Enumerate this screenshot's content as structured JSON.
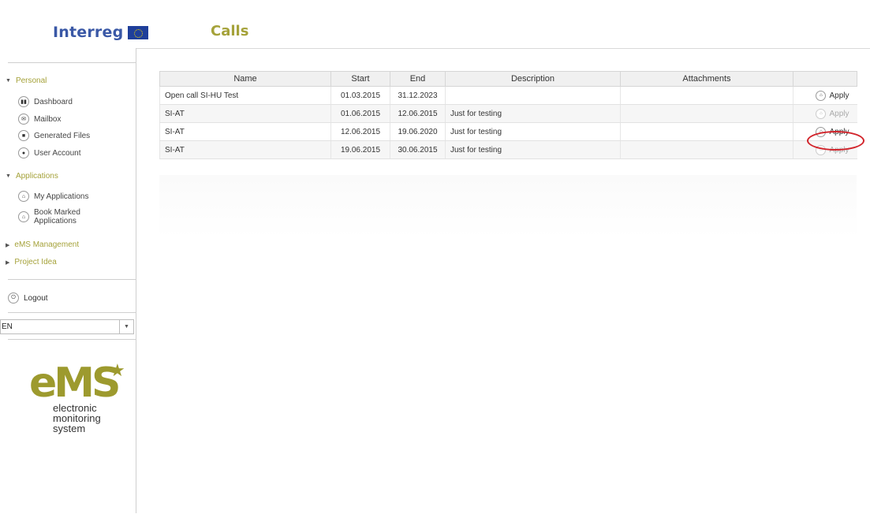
{
  "header": {
    "logo_text": "Interreg",
    "page_title": "Calls"
  },
  "sidebar": {
    "sections": [
      {
        "label": "Personal",
        "expanded": true
      },
      {
        "label": "Applications",
        "expanded": true
      },
      {
        "label": "eMS Management",
        "expanded": false
      },
      {
        "label": "Project Idea",
        "expanded": false
      }
    ],
    "personal_items": [
      {
        "label": "Dashboard",
        "icon": "dashboard-icon"
      },
      {
        "label": "Mailbox",
        "icon": "mail-icon"
      },
      {
        "label": "Generated Files",
        "icon": "files-icon"
      },
      {
        "label": "User Account",
        "icon": "user-icon"
      }
    ],
    "application_items": [
      {
        "label": "My Applications",
        "icon": "applications-icon"
      },
      {
        "label_line1": "Book Marked",
        "label_line2": "Applications",
        "icon": "bookmark-icon"
      }
    ],
    "logout_label": "Logout",
    "language": {
      "selected": "EN"
    },
    "ems_logo": {
      "word": "eMS",
      "line1": "electronic",
      "line2": "monitoring",
      "line3": "system"
    }
  },
  "calls_table": {
    "columns": [
      "Name",
      "Start",
      "End",
      "Description",
      "Attachments",
      ""
    ],
    "rows": [
      {
        "name": "Open call SI-HU Test",
        "start": "01.03.2015",
        "end": "31.12.2023",
        "description": "",
        "attachments": "",
        "action": "Apply",
        "enabled": true
      },
      {
        "name": "SI-AT",
        "start": "01.06.2015",
        "end": "12.06.2015",
        "description": "Just for testing",
        "attachments": "",
        "action": "Apply",
        "enabled": false
      },
      {
        "name": "SI-AT",
        "start": "12.06.2015",
        "end": "19.06.2020",
        "description": "Just for testing",
        "attachments": "",
        "action": "Apply",
        "enabled": true
      },
      {
        "name": "SI-AT",
        "start": "19.06.2015",
        "end": "30.06.2015",
        "description": "Just for testing",
        "attachments": "",
        "action": "Apply",
        "enabled": false
      }
    ]
  },
  "colors": {
    "accent_olive": "#a5a23a",
    "brand_blue": "#3a58a6",
    "highlight_red": "#d2232a"
  }
}
